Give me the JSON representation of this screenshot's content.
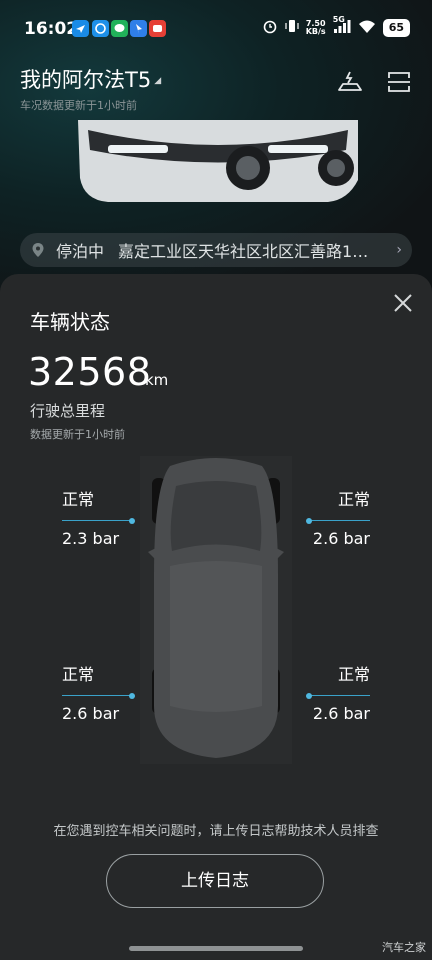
{
  "status_bar": {
    "time": "16:02",
    "app_icons": [
      {
        "name": "plane-app-icon",
        "color": "#1a8be6"
      },
      {
        "name": "browser-app-icon",
        "color": "#1e90e8"
      },
      {
        "name": "chat-app-icon",
        "color": "#21b25a"
      },
      {
        "name": "map-app-icon",
        "color": "#2f7fe8"
      },
      {
        "name": "game-app-icon",
        "color": "#e64036"
      }
    ],
    "net_speed": "7.50",
    "net_unit": "KB/s",
    "net_type": "5G",
    "battery": "65"
  },
  "header": {
    "car_name": "我的阿尔法T5",
    "updated": "车况数据更新于1小时前",
    "icons": [
      "car-lift-icon",
      "scan-icon"
    ]
  },
  "parking": {
    "status": "停泊中",
    "address": "嘉定工业区天华社区北区汇善路1…"
  },
  "sheet": {
    "title": "车辆状态",
    "mileage_value": "32568",
    "mileage_unit": "km",
    "mileage_label": "行驶总里程",
    "updated": "数据更新于1小时前",
    "tires": {
      "front_left": {
        "status": "正常",
        "pressure": "2.3 bar"
      },
      "front_right": {
        "status": "正常",
        "pressure": "2.6 bar"
      },
      "rear_left": {
        "status": "正常",
        "pressure": "2.6 bar"
      },
      "rear_right": {
        "status": "正常",
        "pressure": "2.6 bar"
      }
    },
    "tip": "在您遇到控车相关问题时，请上传日志帮助技术人员排查",
    "upload_button": "上传日志"
  },
  "watermark": "汽车之家",
  "colors": {
    "accent": "#4fb8e0",
    "sheet_bg": "#262829",
    "header_bg": "#0e2224"
  }
}
